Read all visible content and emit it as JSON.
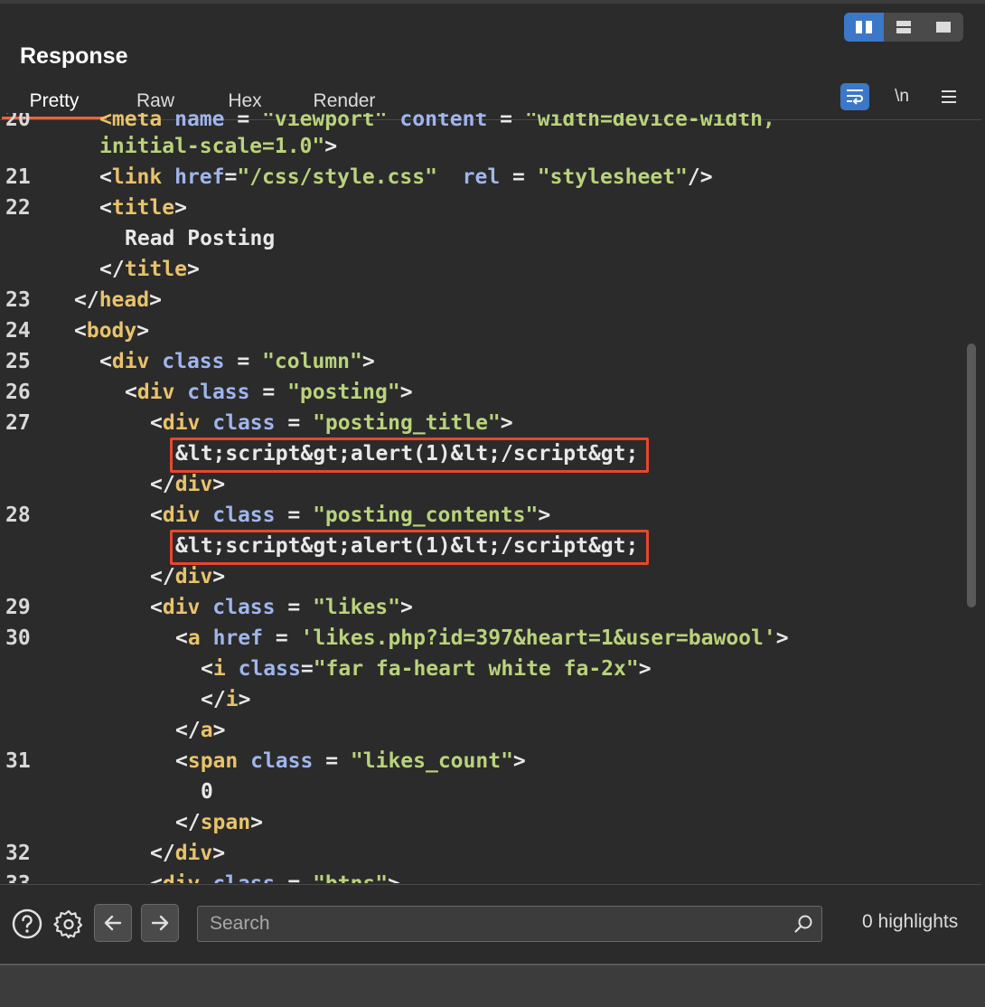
{
  "panel": {
    "title": "Response"
  },
  "layout_toggle": {
    "icons": [
      "split-columns-icon",
      "split-rows-icon",
      "single-pane-icon"
    ]
  },
  "tabs": [
    {
      "label": "Pretty",
      "active": true
    },
    {
      "label": "Raw",
      "active": false
    },
    {
      "label": "Hex",
      "active": false
    },
    {
      "label": "Render",
      "active": false
    }
  ],
  "tools": {
    "newline_label": "\\n"
  },
  "editor": {
    "lines": [
      {
        "num": "20",
        "segments": [
          [
            "tag",
            "<meta "
          ],
          [
            "attr",
            "name"
          ],
          [
            "punct",
            " = "
          ],
          [
            "str",
            "\"viewport\""
          ],
          [
            "punct",
            " "
          ],
          [
            "attr",
            "content"
          ],
          [
            "punct",
            " = "
          ],
          [
            "str",
            "\"width=device-width,"
          ]
        ]
      },
      {
        "num": "",
        "segments": [
          [
            "str",
            "initial-scale=1.0\""
          ],
          [
            "punct",
            ">"
          ]
        ]
      },
      {
        "num": "21",
        "segments": [
          [
            "punct",
            "<"
          ],
          [
            "tag",
            "link"
          ],
          [
            "punct",
            " "
          ],
          [
            "attr",
            "href"
          ],
          [
            "punct",
            "="
          ],
          [
            "str",
            "\"/css/style.css\""
          ],
          [
            "punct",
            "  "
          ],
          [
            "attr",
            "rel"
          ],
          [
            "punct",
            " = "
          ],
          [
            "str",
            "\"stylesheet\""
          ],
          [
            "punct",
            "/>"
          ]
        ]
      },
      {
        "num": "22",
        "segments": [
          [
            "punct",
            "<"
          ],
          [
            "tag",
            "title"
          ],
          [
            "punct",
            ">"
          ]
        ]
      },
      {
        "num": "",
        "segments": [
          [
            "txt",
            "Read Posting"
          ]
        ]
      },
      {
        "num": "",
        "segments": [
          [
            "punct",
            "</"
          ],
          [
            "tag",
            "title"
          ],
          [
            "punct",
            ">"
          ]
        ]
      },
      {
        "num": "23",
        "segments": [
          [
            "punct",
            "</"
          ],
          [
            "tag",
            "head"
          ],
          [
            "punct",
            ">"
          ]
        ]
      },
      {
        "num": "24",
        "segments": [
          [
            "punct",
            "<"
          ],
          [
            "tag",
            "body"
          ],
          [
            "punct",
            ">"
          ]
        ]
      },
      {
        "num": "25",
        "segments": [
          [
            "punct",
            "<"
          ],
          [
            "tag",
            "div"
          ],
          [
            "punct",
            " "
          ],
          [
            "attr",
            "class"
          ],
          [
            "punct",
            " = "
          ],
          [
            "str",
            "\"column\""
          ],
          [
            "punct",
            ">"
          ]
        ]
      },
      {
        "num": "26",
        "segments": [
          [
            "punct",
            "<"
          ],
          [
            "tag",
            "div"
          ],
          [
            "punct",
            " "
          ],
          [
            "attr",
            "class"
          ],
          [
            "punct",
            " = "
          ],
          [
            "str",
            "\"posting\""
          ],
          [
            "punct",
            ">"
          ]
        ]
      },
      {
        "num": "27",
        "segments": [
          [
            "punct",
            "<"
          ],
          [
            "tag",
            "div"
          ],
          [
            "punct",
            " "
          ],
          [
            "attr",
            "class"
          ],
          [
            "punct",
            " = "
          ],
          [
            "str",
            "\"posting_title\""
          ],
          [
            "punct",
            ">"
          ]
        ]
      },
      {
        "num": "",
        "segments": [
          [
            "txt",
            "&lt;script&gt;alert(1)&lt;/script&gt;"
          ]
        ]
      },
      {
        "num": "",
        "segments": [
          [
            "punct",
            "</"
          ],
          [
            "tag",
            "div"
          ],
          [
            "punct",
            ">"
          ]
        ]
      },
      {
        "num": "28",
        "segments": [
          [
            "punct",
            "<"
          ],
          [
            "tag",
            "div"
          ],
          [
            "punct",
            " "
          ],
          [
            "attr",
            "class"
          ],
          [
            "punct",
            " = "
          ],
          [
            "str",
            "\"posting_contents\""
          ],
          [
            "punct",
            ">"
          ]
        ]
      },
      {
        "num": "",
        "segments": [
          [
            "txt",
            "&lt;script&gt;alert(1)&lt;/script&gt;"
          ]
        ]
      },
      {
        "num": "",
        "segments": [
          [
            "punct",
            "</"
          ],
          [
            "tag",
            "div"
          ],
          [
            "punct",
            ">"
          ]
        ]
      },
      {
        "num": "29",
        "segments": [
          [
            "punct",
            "<"
          ],
          [
            "tag",
            "div"
          ],
          [
            "punct",
            " "
          ],
          [
            "attr",
            "class"
          ],
          [
            "punct",
            " = "
          ],
          [
            "str",
            "\"likes\""
          ],
          [
            "punct",
            ">"
          ]
        ]
      },
      {
        "num": "30",
        "segments": [
          [
            "punct",
            "<"
          ],
          [
            "tag",
            "a"
          ],
          [
            "punct",
            " "
          ],
          [
            "attr",
            "href"
          ],
          [
            "punct",
            " = "
          ],
          [
            "str",
            "'likes.php?id=397&heart=1&user=bawool'"
          ],
          [
            "punct",
            ">"
          ]
        ]
      },
      {
        "num": "",
        "segments": [
          [
            "punct",
            "<"
          ],
          [
            "tag",
            "i"
          ],
          [
            "punct",
            " "
          ],
          [
            "attr",
            "class"
          ],
          [
            "punct",
            "="
          ],
          [
            "str",
            "\"far fa-heart white fa-2x\""
          ],
          [
            "punct",
            ">"
          ]
        ]
      },
      {
        "num": "",
        "segments": [
          [
            "punct",
            "</"
          ],
          [
            "tag",
            "i"
          ],
          [
            "punct",
            ">"
          ]
        ]
      },
      {
        "num": "",
        "segments": [
          [
            "punct",
            "</"
          ],
          [
            "tag",
            "a"
          ],
          [
            "punct",
            ">"
          ]
        ]
      },
      {
        "num": "31",
        "segments": [
          [
            "punct",
            "<"
          ],
          [
            "tag",
            "span"
          ],
          [
            "punct",
            " "
          ],
          [
            "attr",
            "class"
          ],
          [
            "punct",
            " = "
          ],
          [
            "str",
            "\"likes_count\""
          ],
          [
            "punct",
            ">"
          ]
        ]
      },
      {
        "num": "",
        "segments": [
          [
            "txt",
            "0"
          ]
        ]
      },
      {
        "num": "",
        "segments": [
          [
            "punct",
            "</"
          ],
          [
            "tag",
            "span"
          ],
          [
            "punct",
            ">"
          ]
        ]
      },
      {
        "num": "32",
        "segments": [
          [
            "punct",
            "</"
          ],
          [
            "tag",
            "div"
          ],
          [
            "punct",
            ">"
          ]
        ]
      },
      {
        "num": "33",
        "segments": [
          [
            "punct",
            "<"
          ],
          [
            "tag",
            "div"
          ],
          [
            "punct",
            " "
          ],
          [
            "attr",
            "class"
          ],
          [
            "punct",
            " = "
          ],
          [
            "str",
            "\"btns\""
          ],
          [
            "punct",
            ">"
          ]
        ]
      }
    ]
  },
  "search": {
    "placeholder": "Search",
    "value": ""
  },
  "status": {
    "highlights": "0 highlights"
  },
  "colors": {
    "accent": "#3b78c8",
    "tab_underline": "#e8633f",
    "highlight_box": "#e8462d",
    "tag": "#e8c36c",
    "attr": "#9fb6ec",
    "string": "#b9d37b"
  }
}
